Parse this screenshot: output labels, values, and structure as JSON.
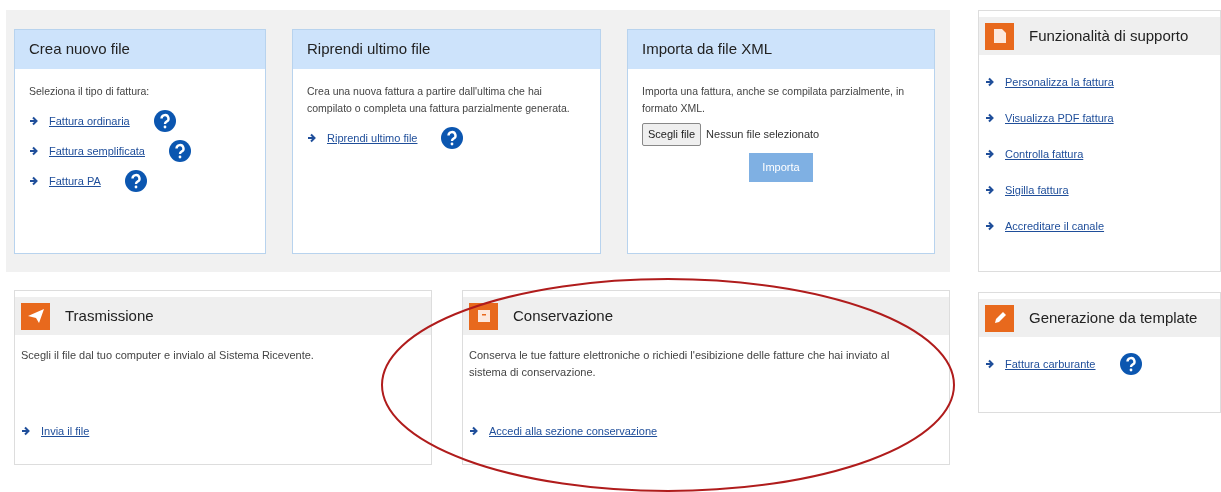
{
  "main_cards": [
    {
      "title": "Crea nuovo file",
      "description": "Seleziona il tipo di fattura:",
      "links": [
        {
          "label": "Fattura ordinaria",
          "help": true
        },
        {
          "label": "Fattura semplificata",
          "help": true
        },
        {
          "label": "Fattura PA",
          "help": true
        }
      ]
    },
    {
      "title": "Riprendi ultimo file",
      "description": "Crea una nuova fattura a partire dall'ultima che hai compilato o completa una fattura parzialmente generata.",
      "links": [
        {
          "label": "Riprendi ultimo file",
          "help": true
        }
      ]
    },
    {
      "title": "Importa da file XML",
      "description": "Importa una fattura, anche se compilata parzialmente, in formato XML.",
      "file_button": "Scegli file",
      "file_status": "Nessun file selezionato",
      "submit": {
        "label": "Importa",
        "disabled": true
      }
    }
  ],
  "support_panel": {
    "title": "Funzionalità di supporto",
    "links": [
      {
        "label": "Personalizza la fattura",
        "help": false
      },
      {
        "label": "Visualizza PDF fattura",
        "help": false
      },
      {
        "label": "Controlla fattura",
        "help": false
      },
      {
        "label": "Sigilla fattura",
        "help": false
      },
      {
        "label": "Accreditare il canale",
        "help": false
      }
    ]
  },
  "bottom_cards": [
    {
      "title": "Trasmissione",
      "description": "Scegli il file dal tuo computer e invialo al Sistema Ricevente.",
      "links": [
        {
          "label": "Invia il file",
          "help": false
        }
      ]
    },
    {
      "title": "Conservazione",
      "description": "Conserva le tue fatture elettroniche o richiedi l'esibizione delle fatture che hai inviato al sistema di conservazione.",
      "links": [
        {
          "label": "Accedi alla sezione conservazione",
          "help": false
        }
      ]
    }
  ],
  "template_panel": {
    "title": "Generazione da template",
    "links": [
      {
        "label": "Fattura carburante",
        "help": true
      }
    ]
  }
}
